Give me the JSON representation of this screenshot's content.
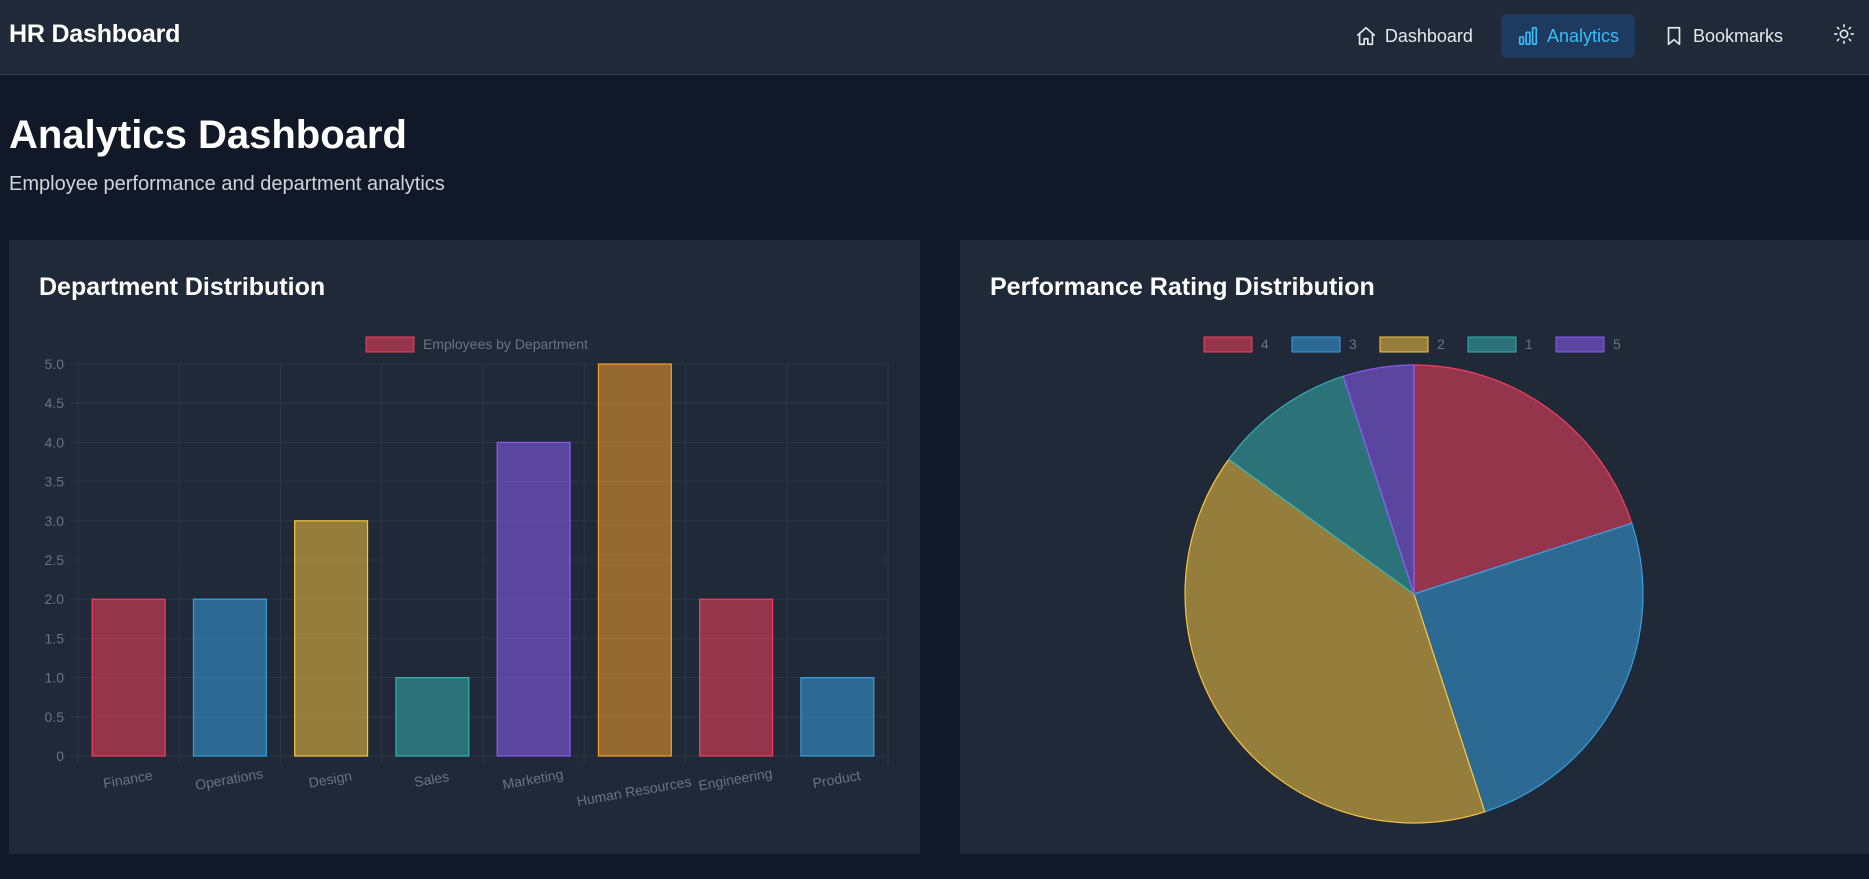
{
  "app": {
    "brand": "HR Dashboard",
    "nav": [
      {
        "label": "Dashboard",
        "icon": "home-icon",
        "active": false
      },
      {
        "label": "Analytics",
        "icon": "bar-chart-icon",
        "active": true
      },
      {
        "label": "Bookmarks",
        "icon": "bookmark-icon",
        "active": false
      }
    ],
    "theme_toggle_icon": "sun-icon"
  },
  "page": {
    "title": "Analytics Dashboard",
    "subtitle": "Employee performance and department analytics"
  },
  "colors": {
    "red": "#f43f5e",
    "blue": "#38a0e0",
    "yellow": "#f5c542",
    "teal": "#34b1b1",
    "purple": "#8b5cf6",
    "orange": "#f59e2b",
    "fill_alpha": 0.55,
    "grid": "#2b3544",
    "tick": "#6b7280",
    "legend_text": "#6b7280",
    "accent": "#38bdf8"
  },
  "cards": {
    "department": {
      "title": "Department Distribution"
    },
    "performance": {
      "title": "Performance Rating Distribution"
    }
  },
  "chart_data": [
    {
      "type": "bar",
      "title": "Department Distribution",
      "legend": [
        "Employees by Department"
      ],
      "legend_position": "top",
      "categories": [
        "Finance",
        "Operations",
        "Design",
        "Sales",
        "Marketing",
        "Human Resources",
        "Engineering",
        "Product"
      ],
      "series": [
        {
          "name": "Employees by Department",
          "values": [
            2,
            2,
            3,
            1,
            4,
            5,
            2,
            1
          ]
        }
      ],
      "bar_colors": [
        "red",
        "blue",
        "yellow",
        "teal",
        "purple",
        "orange",
        "red",
        "blue"
      ],
      "ylim": [
        0,
        5
      ],
      "yticks": [
        "0",
        "0.5",
        "1.0",
        "1.5",
        "2.0",
        "2.5",
        "3.0",
        "3.5",
        "4.0",
        "4.5",
        "5.0"
      ],
      "grid": true
    },
    {
      "type": "pie",
      "title": "Performance Rating Distribution",
      "legend_position": "top",
      "labels": [
        "4",
        "3",
        "2",
        "1",
        "5"
      ],
      "values": [
        4,
        5,
        8,
        2,
        1
      ],
      "slice_colors": [
        "red",
        "blue",
        "yellow",
        "teal",
        "purple"
      ]
    }
  ]
}
